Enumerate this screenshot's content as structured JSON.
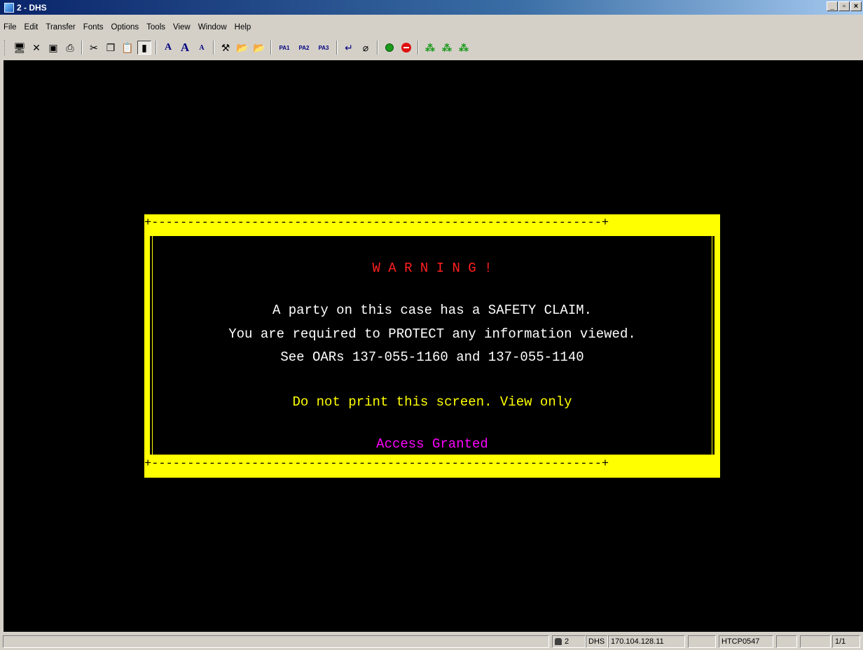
{
  "window": {
    "title": "2 - DHS",
    "minimize": "_",
    "maximize": "▫",
    "close": "×"
  },
  "menu": [
    "File",
    "Edit",
    "Transfer",
    "Fonts",
    "Options",
    "Tools",
    "View",
    "Window",
    "Help"
  ],
  "toolbar": {
    "pa1": "PA1",
    "pa2": "PA2",
    "pa3": "PA3"
  },
  "terminal": {
    "border_top": "+---------------------------------------------------------------+",
    "border_bottom": "+---------------------------------------------------------------+",
    "warning": "W A R N I N G !",
    "line1": "A party on this case has a SAFETY CLAIM.",
    "line2": "You are required to PROTECT any information viewed.",
    "line3": "See OARs 137-055-1160 and 137-055-1140",
    "notice": "Do not print this screen. View only",
    "access": "Access Granted",
    "colors": {
      "warning": "#ff2020",
      "body": "#ffffff",
      "notice": "#ffff00",
      "access": "#ff00ff",
      "frame": "#ffff00"
    }
  },
  "status": {
    "session": "2",
    "host_name": "DHS",
    "ip": "170.104.128.11",
    "lu": "HTCP0547",
    "page": "1/1"
  }
}
